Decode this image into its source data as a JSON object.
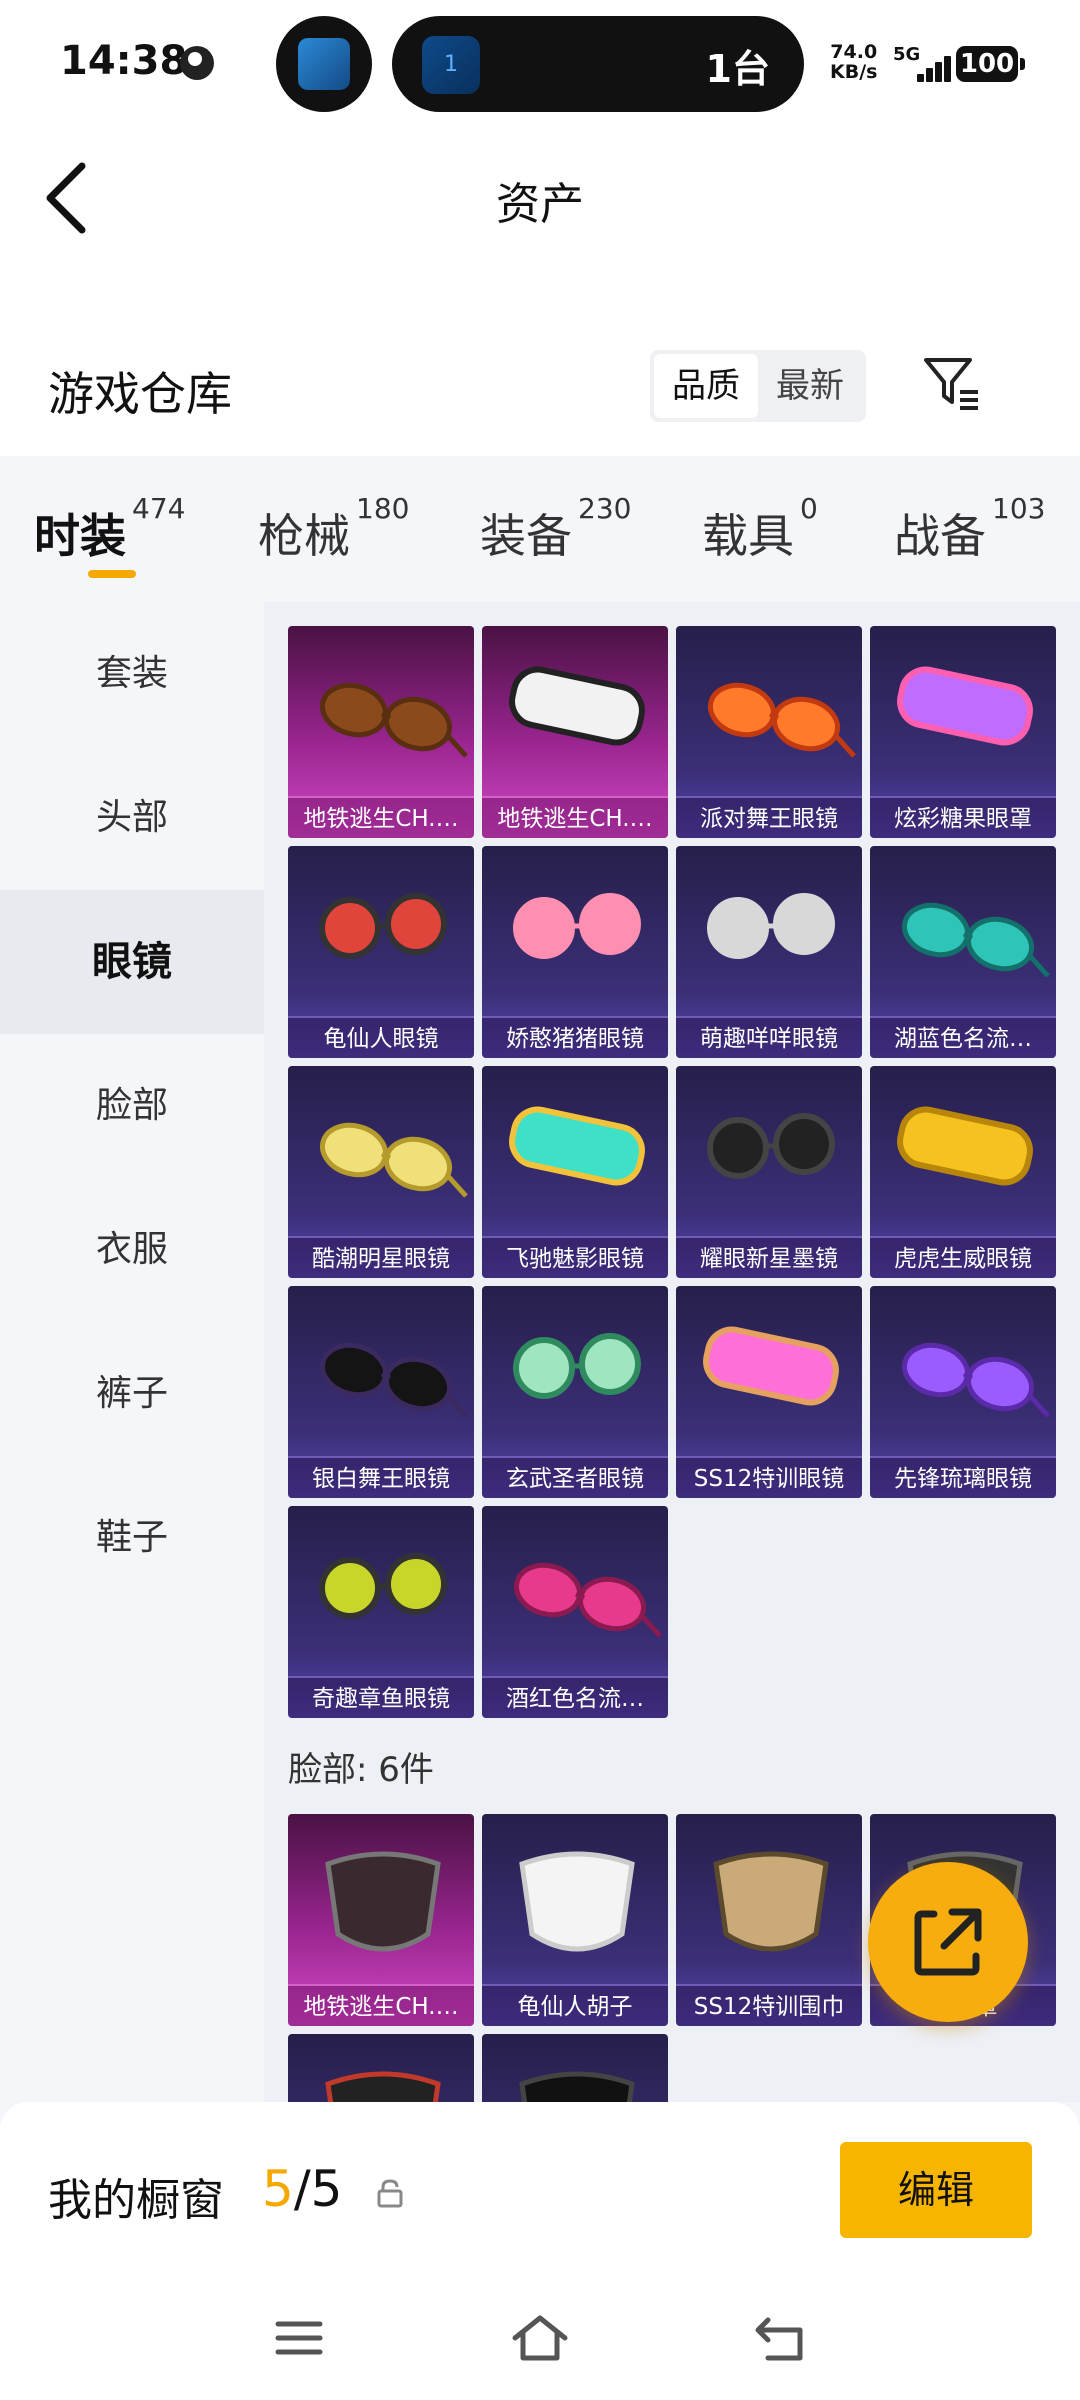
{
  "status_bar": {
    "time": "14:38",
    "island_badge": "1",
    "island_text": "1台",
    "speed_value": "74.0",
    "speed_unit": "KB/s",
    "network": "5G",
    "battery": "100"
  },
  "header": {
    "title": "资产"
  },
  "warehouse": {
    "title": "游戏仓库",
    "sort_options": [
      "品质",
      "最新"
    ],
    "active_sort": "品质"
  },
  "tabs": [
    {
      "label": "时装",
      "count": "474"
    },
    {
      "label": "枪械",
      "count": "180"
    },
    {
      "label": "装备",
      "count": "230"
    },
    {
      "label": "载具",
      "count": "0"
    },
    {
      "label": "战备",
      "count": "103"
    }
  ],
  "sidebar": {
    "items": [
      "套装",
      "头部",
      "眼镜",
      "脸部",
      "衣服",
      "裤子",
      "鞋子"
    ],
    "active": "眼镜"
  },
  "glasses_items": [
    {
      "name": "地铁逃生CH.…",
      "rarity": "pink",
      "art": "sunglasses-brown"
    },
    {
      "name": "地铁逃生CH.…",
      "rarity": "pink",
      "art": "goggles-white"
    },
    {
      "name": "派对舞王眼镜",
      "rarity": "purple",
      "art": "aviator-orange"
    },
    {
      "name": "炫彩糖果眼罩",
      "rarity": "purple",
      "art": "candy-mask"
    },
    {
      "name": "龟仙人眼镜",
      "rarity": "purple",
      "art": "round-red"
    },
    {
      "name": "娇憨猪猪眼镜",
      "rarity": "purple",
      "art": "pink-frames"
    },
    {
      "name": "萌趣咩咩眼镜",
      "rarity": "purple",
      "art": "silver-frames"
    },
    {
      "name": "湖蓝色名流…",
      "rarity": "purple",
      "art": "aviator-teal"
    },
    {
      "name": "酷潮明星眼镜",
      "rarity": "purple",
      "art": "aviator-yellow"
    },
    {
      "name": "飞驰魅影眼镜",
      "rarity": "purple",
      "art": "visor-teal"
    },
    {
      "name": "耀眼新星墨镜",
      "rarity": "purple",
      "art": "round-black"
    },
    {
      "name": "虎虎生威眼镜",
      "rarity": "purple",
      "art": "goggles-yellow"
    },
    {
      "name": "银白舞王眼镜",
      "rarity": "purple",
      "art": "shades-black"
    },
    {
      "name": "玄武圣者眼镜",
      "rarity": "purple",
      "art": "spiral-green"
    },
    {
      "name": "SS12特训眼镜",
      "rarity": "purple",
      "art": "goggles-pink"
    },
    {
      "name": "先锋琉璃眼镜",
      "rarity": "purple",
      "art": "aviator-violet"
    },
    {
      "name": "奇趣章鱼眼镜",
      "rarity": "purple",
      "art": "round-lime"
    },
    {
      "name": "酒红色名流…",
      "rarity": "purple",
      "art": "aviator-magenta"
    }
  ],
  "face_group_label": "脸部: 6件",
  "face_items": [
    {
      "name": "地铁逃生CH.…",
      "rarity": "pink",
      "art": "mask-studded"
    },
    {
      "name": "龟仙人胡子",
      "rarity": "purple",
      "art": "beard-white"
    },
    {
      "name": "SS12特训围巾",
      "rarity": "purple",
      "art": "scarf-khaki"
    },
    {
      "name": "…面罩",
      "rarity": "purple",
      "art": "face-mask"
    },
    {
      "name": "",
      "rarity": "purple",
      "art": "mask-red"
    },
    {
      "name": "",
      "rarity": "purple",
      "art": "mask-dark"
    }
  ],
  "showcase": {
    "title": "我的橱窗",
    "current": "5",
    "total": "/5",
    "edit_label": "编辑"
  },
  "colors": {
    "accent": "#f5a800",
    "card_purple": "#3c2f78",
    "card_pink": "#9a2590"
  },
  "icons": {
    "back": "chevron-left-icon",
    "filter": "funnel-icon",
    "share": "external-link-icon",
    "lock": "lock-icon"
  }
}
